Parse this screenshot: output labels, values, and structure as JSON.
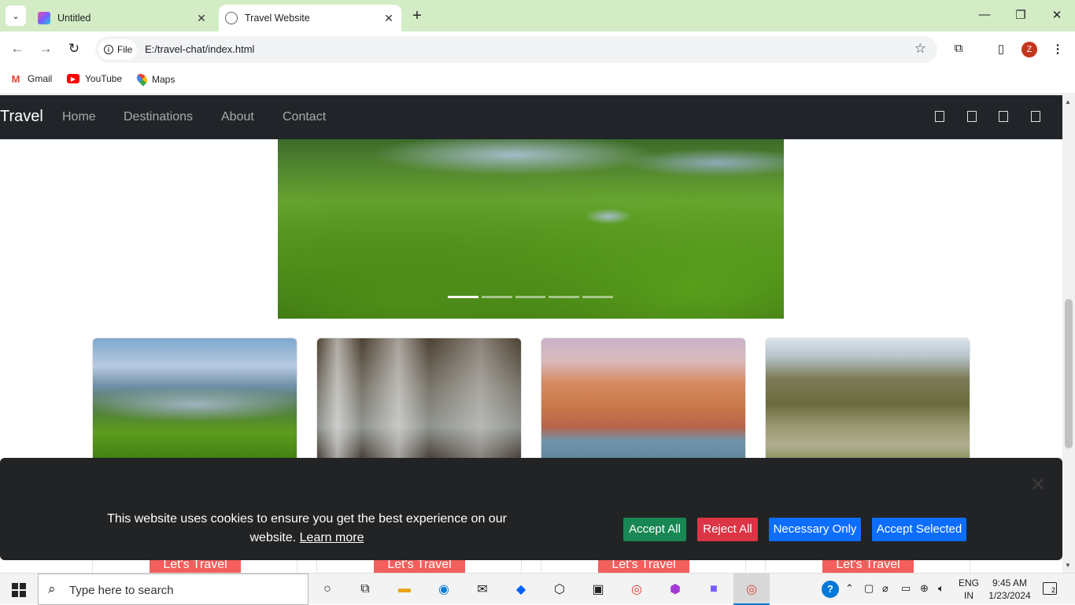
{
  "browser": {
    "tabs": [
      {
        "title": "Untitled",
        "active": false
      },
      {
        "title": "Travel Website",
        "active": true
      }
    ],
    "address": {
      "chip": "File",
      "url": "E:/travel-chat/index.html"
    },
    "profile_initial": "Z",
    "bookmarks": [
      "Gmail",
      "YouTube",
      "Maps"
    ]
  },
  "site": {
    "brand": "Travel",
    "nav": [
      "Home",
      "Destinations",
      "About",
      "Contact"
    ],
    "social_icon_count": 4,
    "carousel": {
      "slides": 5,
      "active_index": 0
    },
    "cards": [
      {
        "image": "tea-hills",
        "button": "Let's Travel"
      },
      {
        "image": "waterfall",
        "button": "Let's Travel"
      },
      {
        "image": "ghats-city",
        "button": "Let's Travel"
      },
      {
        "image": "mountain-bridge",
        "button": "Let's Travel"
      }
    ]
  },
  "cookie": {
    "message": "This website uses cookies to ensure you get the best experience on our website.",
    "link": "Learn more",
    "buttons": {
      "accept_all": "Accept All",
      "reject_all": "Reject All",
      "necessary": "Necessary Only",
      "accept_selected": "Accept Selected"
    },
    "colors": {
      "accept": "#198754",
      "reject": "#dc3545",
      "primary": "#0d6efd"
    }
  },
  "taskbar": {
    "search_placeholder": "Type here to search",
    "lang": [
      "ENG",
      "IN"
    ],
    "time": "9:45 AM",
    "date": "1/23/2024",
    "notifications": "2"
  }
}
